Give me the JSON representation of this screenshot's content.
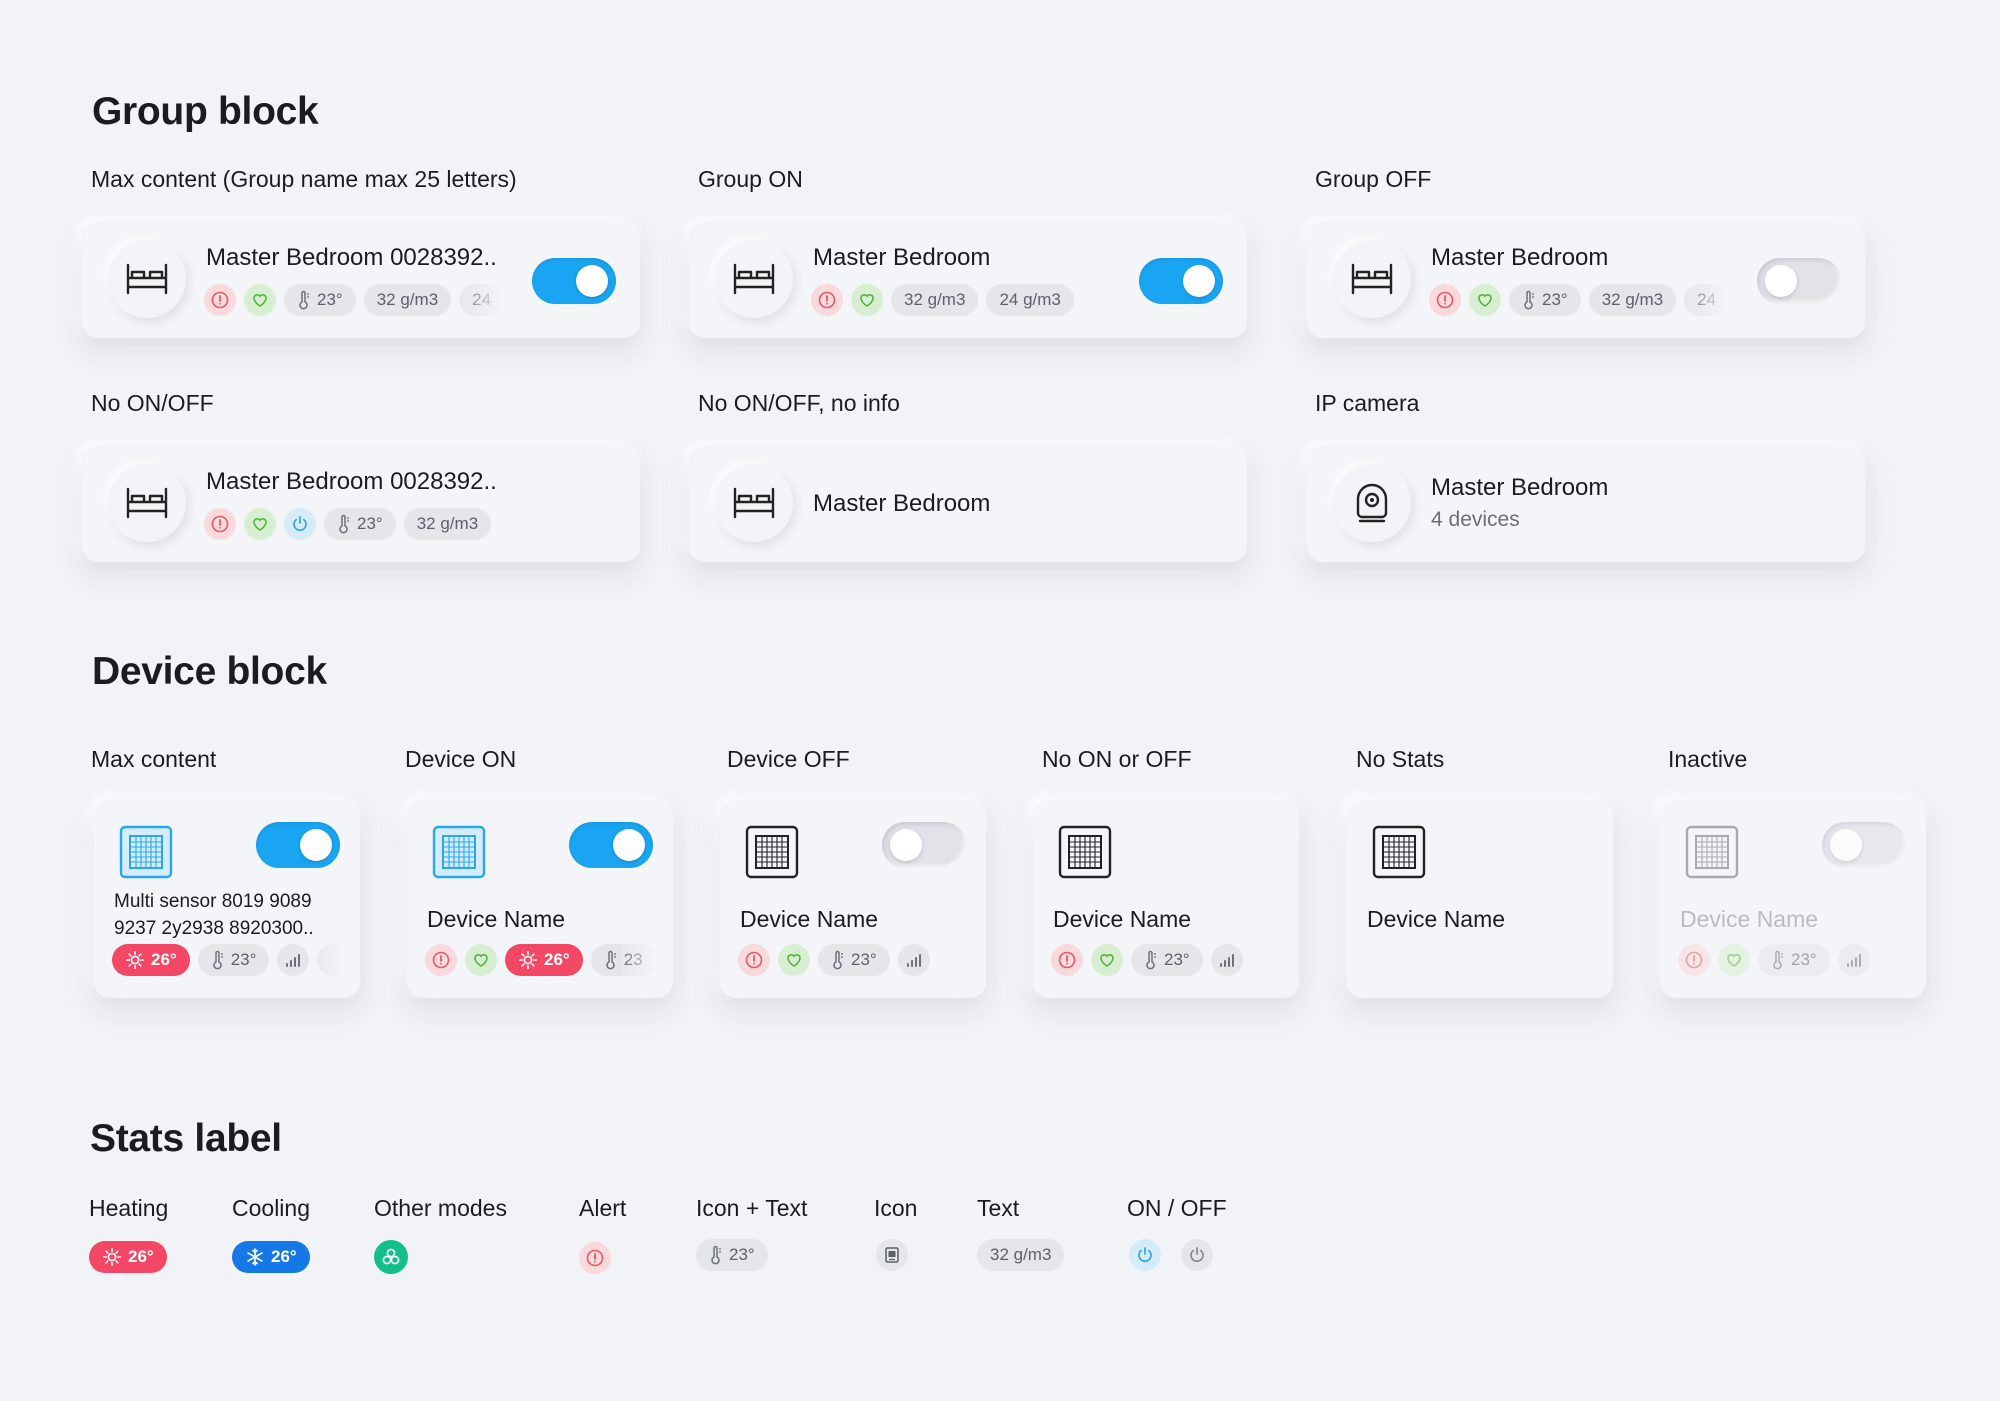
{
  "group_block": {
    "title": "Group block",
    "cards": [
      {
        "caption": "Max content (Group name max 25 letters)",
        "name": "Master Bedroom 0028392..",
        "temp": "23°",
        "chip1": "32 g/m3",
        "chip2": "24"
      },
      {
        "caption": "Group ON",
        "name": "Master Bedroom",
        "chip1": "32 g/m3",
        "chip2": "24 g/m3"
      },
      {
        "caption": "Group OFF",
        "name": "Master Bedroom",
        "temp": "23°",
        "chip1": "32 g/m3",
        "chip2": "24"
      },
      {
        "caption": "No ON/OFF",
        "name": "Master Bedroom 0028392..",
        "temp": "23°",
        "chip1": "32 g/m3"
      },
      {
        "caption": "No ON/OFF, no info",
        "name": "Master Bedroom"
      },
      {
        "caption": "IP camera",
        "name": "Master Bedroom",
        "subtitle": "4 devices"
      }
    ]
  },
  "device_block": {
    "title": "Device block",
    "cards": [
      {
        "caption": "Max content",
        "name": "Multi sensor 8019 9089 9237 2y2938 8920300..",
        "heat": "26°",
        "temp": "23°",
        "toggle": "on"
      },
      {
        "caption": "Device ON",
        "name": "Device Name",
        "heat": "26°",
        "temp": "23",
        "toggle": "on"
      },
      {
        "caption": "Device OFF",
        "name": "Device Name",
        "temp": "23°",
        "toggle": "off"
      },
      {
        "caption": "No ON or OFF",
        "name": "Device Name",
        "temp": "23°"
      },
      {
        "caption": "No Stats",
        "name": "Device Name"
      },
      {
        "caption": "Inactive",
        "name": "Device Name",
        "temp": "23°",
        "toggle": "off"
      }
    ]
  },
  "stats_label": {
    "title": "Stats label",
    "items": [
      {
        "caption": "Heating",
        "value": "26°"
      },
      {
        "caption": "Cooling",
        "value": "26°"
      },
      {
        "caption": "Other modes"
      },
      {
        "caption": "Alert"
      },
      {
        "caption": "Icon + Text",
        "value": "23°"
      },
      {
        "caption": "Icon"
      },
      {
        "caption": "Text",
        "value": "32 g/m3"
      },
      {
        "caption": "ON / OFF"
      }
    ]
  },
  "colors": {
    "accent_blue": "#1aa5f2",
    "heating_red": "#f24866",
    "cooling_blue": "#1677e6",
    "mode_green": "#14c08a",
    "alert_pink": "#f9d9dc",
    "health_green": "#d8eed2"
  },
  "icons": [
    "bed-icon",
    "camera-icon",
    "ac-unit-icon",
    "alert-icon",
    "heart-icon",
    "power-icon",
    "thermometer-icon",
    "signal-icon",
    "sun-icon",
    "snowflake-icon",
    "fan-icon",
    "device-icon"
  ]
}
